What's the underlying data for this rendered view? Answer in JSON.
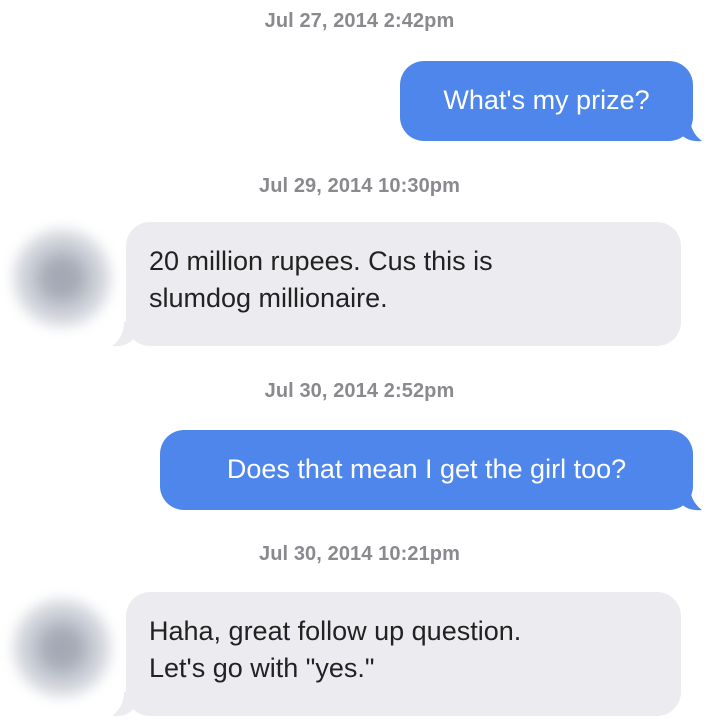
{
  "messages": [
    {
      "timestamp": "Jul 27, 2014 2:42pm",
      "direction": "outgoing",
      "text": "What's my prize?"
    },
    {
      "timestamp": "Jul 29, 2014 10:30pm",
      "direction": "incoming",
      "lines": [
        "20 million rupees. Cus this is",
        "slumdog millionaire."
      ]
    },
    {
      "timestamp": "Jul 30, 2014 2:52pm",
      "direction": "outgoing",
      "text": "Does that mean I get the girl too?"
    },
    {
      "timestamp": "Jul 30, 2014 10:21pm",
      "direction": "incoming",
      "lines": [
        "Haha, great follow up question.",
        "Let's go with \"yes.\""
      ]
    }
  ],
  "colors": {
    "outgoing_bubble": "#4f86ec",
    "incoming_bubble": "#ececf0",
    "timestamp_text": "#8a8a8e"
  },
  "icons": {
    "avatar": "blurred-avatar-icon"
  }
}
